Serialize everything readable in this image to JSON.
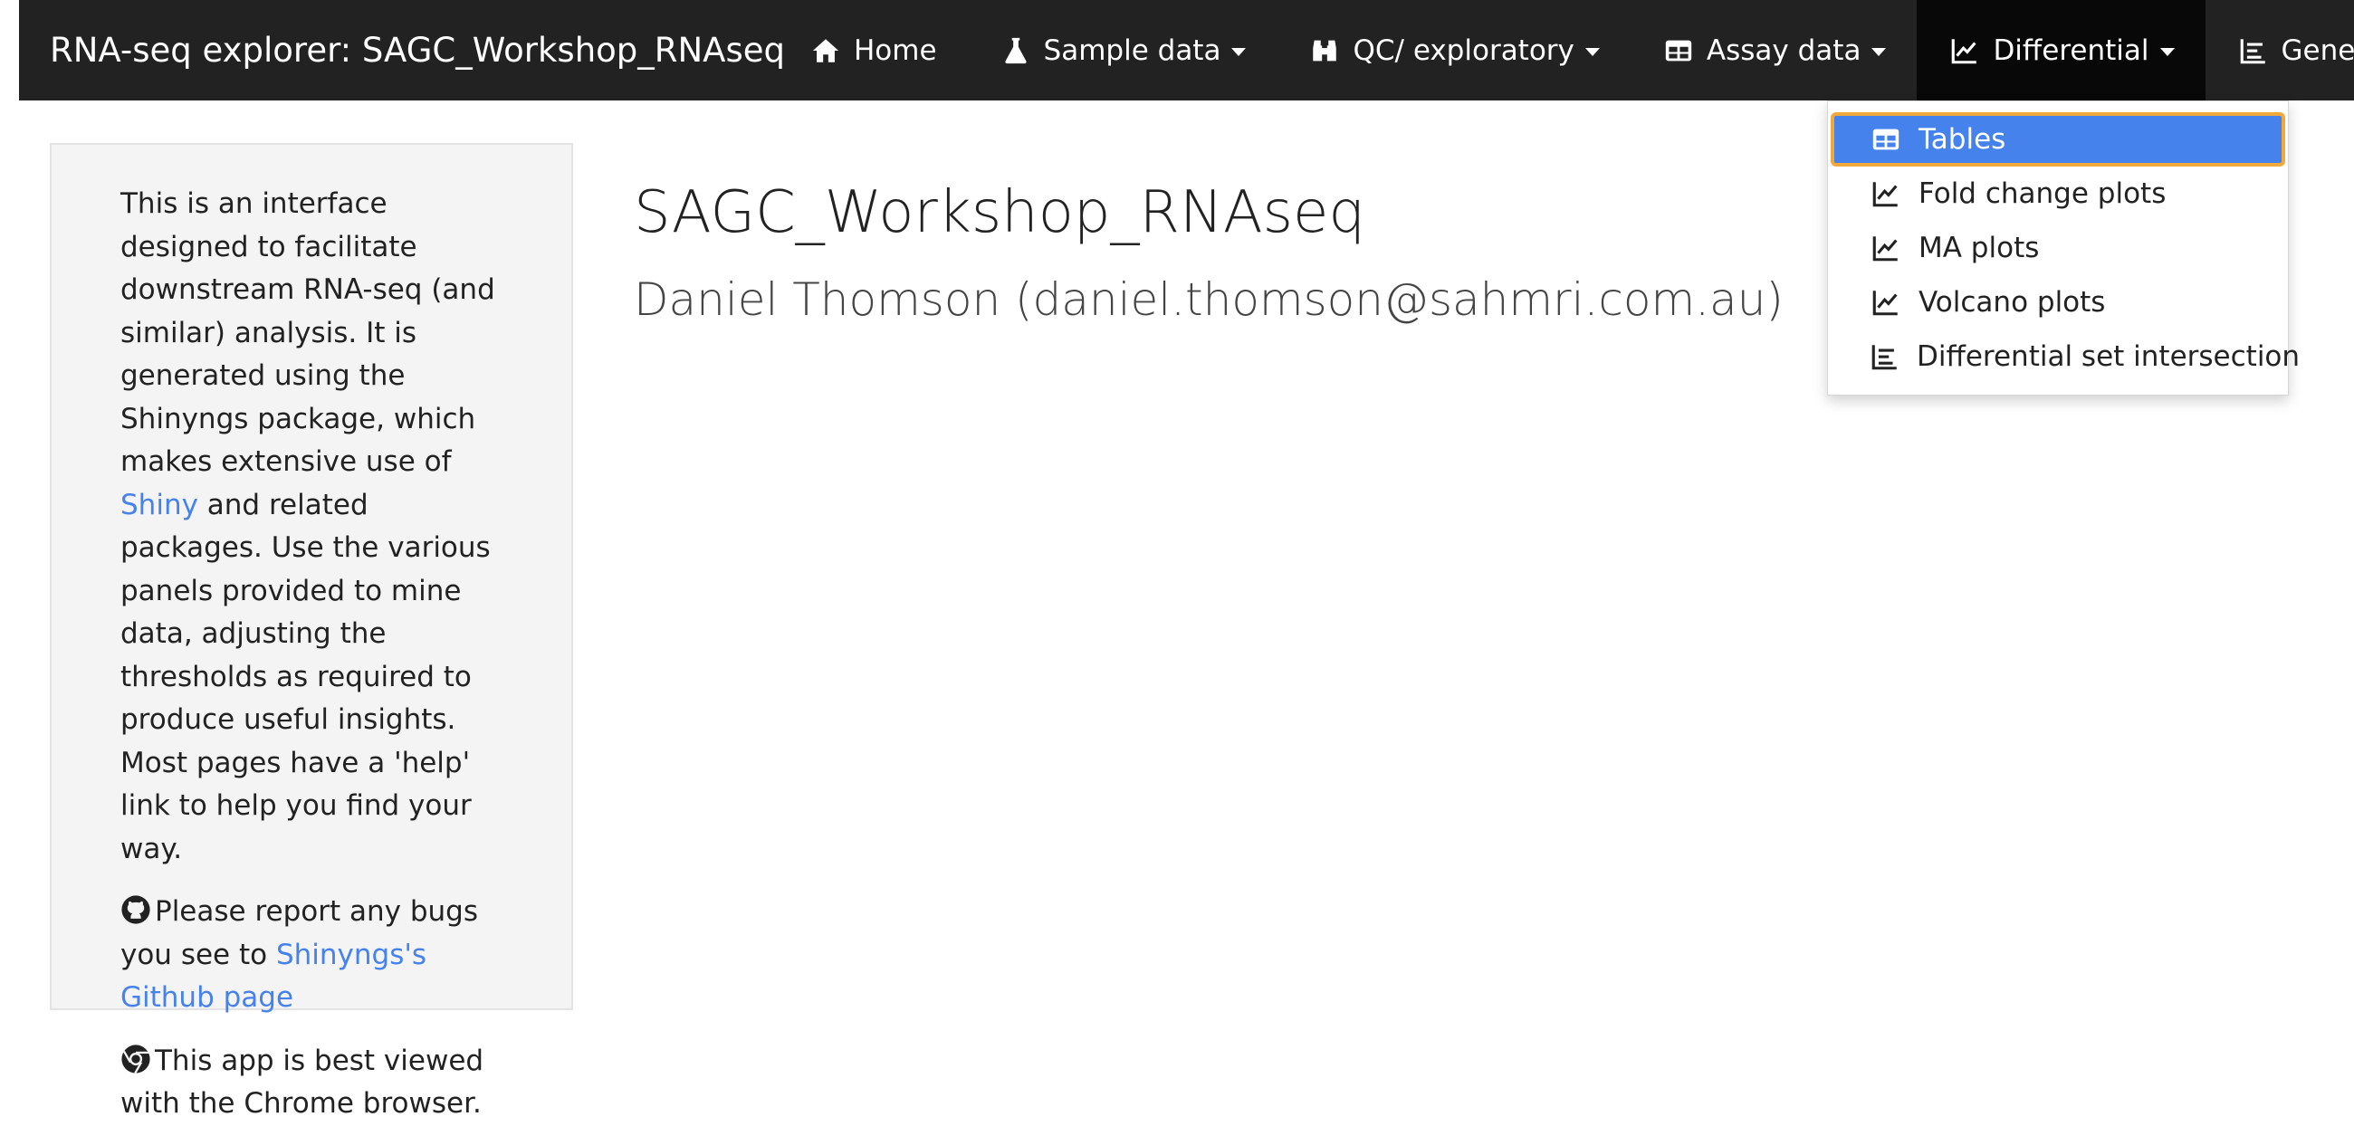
{
  "navbar": {
    "brand": "RNA-seq explorer: SAGC_Workshop_RNAseq",
    "items": [
      {
        "label": "Home",
        "icon": "home-icon",
        "dropdown": false
      },
      {
        "label": "Sample data",
        "icon": "flask-icon",
        "dropdown": true
      },
      {
        "label": "QC/ exploratory",
        "icon": "binoculars-icon",
        "dropdown": true
      },
      {
        "label": "Assay data",
        "icon": "table-icon",
        "dropdown": true
      },
      {
        "label": "Differential",
        "icon": "line-chart-icon",
        "dropdown": true
      },
      {
        "label": "Gene info",
        "icon": "bar-chart-icon",
        "dropdown": false
      }
    ]
  },
  "dropdown": {
    "items": [
      {
        "label": "Tables",
        "icon": "table-icon"
      },
      {
        "label": "Fold change plots",
        "icon": "line-chart-icon"
      },
      {
        "label": "MA plots",
        "icon": "line-chart-icon"
      },
      {
        "label": "Volcano plots",
        "icon": "line-chart-icon"
      },
      {
        "label": "Differential set intersection",
        "icon": "bar-chart-icon"
      }
    ],
    "selected": "Tables"
  },
  "sidebar": {
    "intro_before_link": "This is an interface designed to facilitate downstream RNA-seq (and similar) analysis. It is generated using the Shinyngs package, which makes extensive use of ",
    "shiny_link": "Shiny",
    "intro_after_link": " and related packages. Use the various panels provided to mine data, adjusting the thresholds as required to produce useful insights. Most pages have a 'help' link to help you find your way.",
    "bugs_text": "Please report any bugs you see to ",
    "github_link": "Shinyngs's Github page",
    "chrome_text": "This app is best viewed with the Chrome browser."
  },
  "main": {
    "title": "SAGC_Workshop_RNAseq",
    "subtitle": "Daniel Thomson (daniel.thomson@sahmri.com.au)"
  },
  "colors": {
    "navbar_bg": "#222222",
    "active_nav_bg": "#080808",
    "selected_bg": "#4582ec",
    "selected_border": "#f0a93a",
    "link": "#4582ec",
    "sidebar_bg": "#f4f4f4"
  }
}
